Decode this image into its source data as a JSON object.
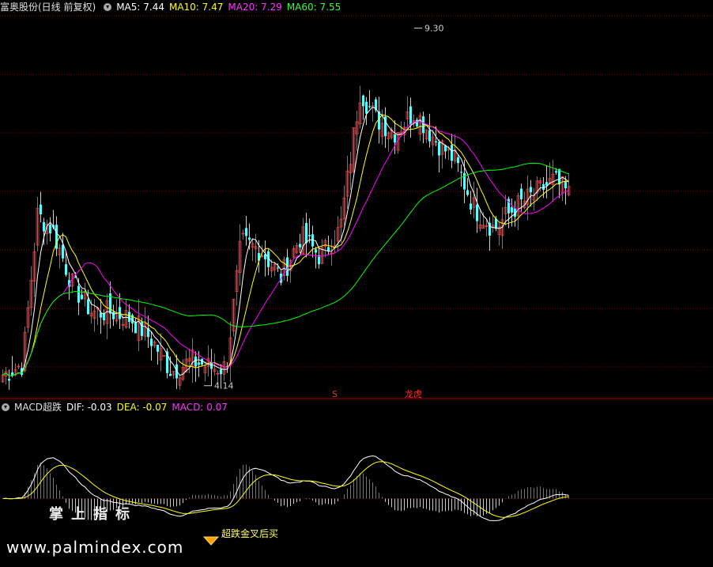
{
  "main_header": {
    "title": "富奥股份(日线 前复权)",
    "ma5_label": "MA5: 7.44",
    "ma10_label": "MA10: 7.47",
    "ma20_label": "MA20: 7.29",
    "ma60_label": "MA60: 7.55"
  },
  "macd_header": {
    "title": "MACD超跌",
    "dif_label": "DIF: -0.03",
    "dea_label": "DEA: -0.07",
    "macd_label": "MACD: 0.07"
  },
  "annotations": {
    "high_label": "9.30",
    "low_label": "4.14",
    "marker_s": "S",
    "marker_longhu": "龙虎",
    "signal_text": "超跌金叉后买"
  },
  "watermark": {
    "line1": "掌上指标",
    "line2": "www.palmindex.com"
  },
  "colors": {
    "up": "#ff3a3a",
    "down": "#54ffff",
    "ma5": "#ffffff",
    "ma10": "#ffff00",
    "ma20": "#ff00ff",
    "ma60": "#00ff00",
    "dif": "#ffffff",
    "dea": "#ffff00",
    "grid": "#8b0000",
    "signal": "#ffa500"
  },
  "chart_data": {
    "type": "candlestick",
    "price_axis": {
      "range": [
        4.0,
        9.5
      ],
      "grid": true
    },
    "summary": {
      "high": 9.3,
      "low": 4.14,
      "bars": 180
    },
    "ohlc_anchor_closes": [
      [
        0,
        4.3
      ],
      [
        8,
        4.45
      ],
      [
        14,
        6.6
      ],
      [
        20,
        6.4
      ],
      [
        28,
        5.6
      ],
      [
        36,
        5.2
      ],
      [
        44,
        5.2
      ],
      [
        52,
        5.1
      ],
      [
        60,
        4.8
      ],
      [
        68,
        4.35
      ],
      [
        76,
        4.5
      ],
      [
        84,
        4.4
      ],
      [
        90,
        4.4
      ],
      [
        96,
        6.2
      ],
      [
        104,
        6.1
      ],
      [
        112,
        5.7
      ],
      [
        120,
        6.3
      ],
      [
        128,
        6.0
      ],
      [
        136,
        6.4
      ],
      [
        144,
        8.4
      ],
      [
        150,
        8.0
      ],
      [
        158,
        7.8
      ],
      [
        166,
        8.1
      ],
      [
        174,
        7.7
      ],
      [
        182,
        7.4
      ],
      [
        190,
        6.7
      ],
      [
        198,
        6.4
      ],
      [
        206,
        6.7
      ],
      [
        214,
        6.9
      ],
      [
        222,
        7.1
      ],
      [
        228,
        6.9
      ]
    ],
    "macd": {
      "range": [
        -0.9,
        1.25
      ],
      "dif_label": "DIF",
      "dea_label": "DEA",
      "hist_label": "MACD"
    }
  }
}
